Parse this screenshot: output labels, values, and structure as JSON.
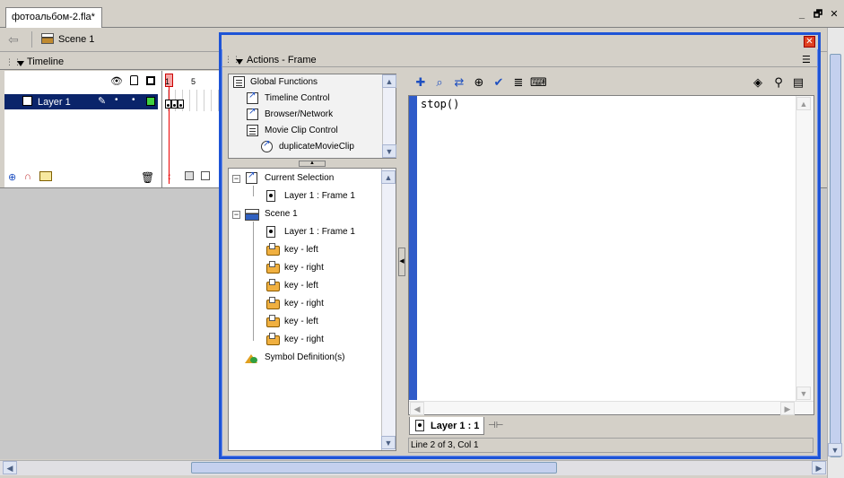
{
  "document_tab": {
    "title": "фотоальбом-2.fla*"
  },
  "window_controls": {
    "minimize": "_",
    "restore": "🗗",
    "close": "✕"
  },
  "edit_bar": {
    "scene_label": "Scene 1"
  },
  "timeline": {
    "title": "Timeline",
    "layer_name": "Layer 1",
    "frame_numbers": [
      "1",
      "5"
    ]
  },
  "actions_panel": {
    "title": "Actions - Frame",
    "close_label": "✕",
    "toolbox": [
      {
        "label": "Global Functions",
        "icon": "book-icon"
      },
      {
        "label": "Timeline Control",
        "icon": "function-icon"
      },
      {
        "label": "Browser/Network",
        "icon": "function-icon"
      },
      {
        "label": "Movie Clip Control",
        "icon": "book-icon"
      },
      {
        "label": "duplicateMovieClip",
        "icon": "function-icon"
      }
    ],
    "tree": {
      "current_selection": "Current Selection",
      "current_frame": "Layer 1 : Frame 1",
      "scene": "Scene 1",
      "scene_frame": "Layer 1 : Frame 1",
      "buttons": [
        "key - left",
        "key - right",
        "key - left",
        "key - right",
        "key - left",
        "key - right"
      ],
      "symbol_definitions": "Symbol Definition(s)"
    },
    "script": {
      "code": "stop()"
    },
    "script_tab": "Layer 1 : 1",
    "status": "Line 2 of 3, Col 1"
  }
}
